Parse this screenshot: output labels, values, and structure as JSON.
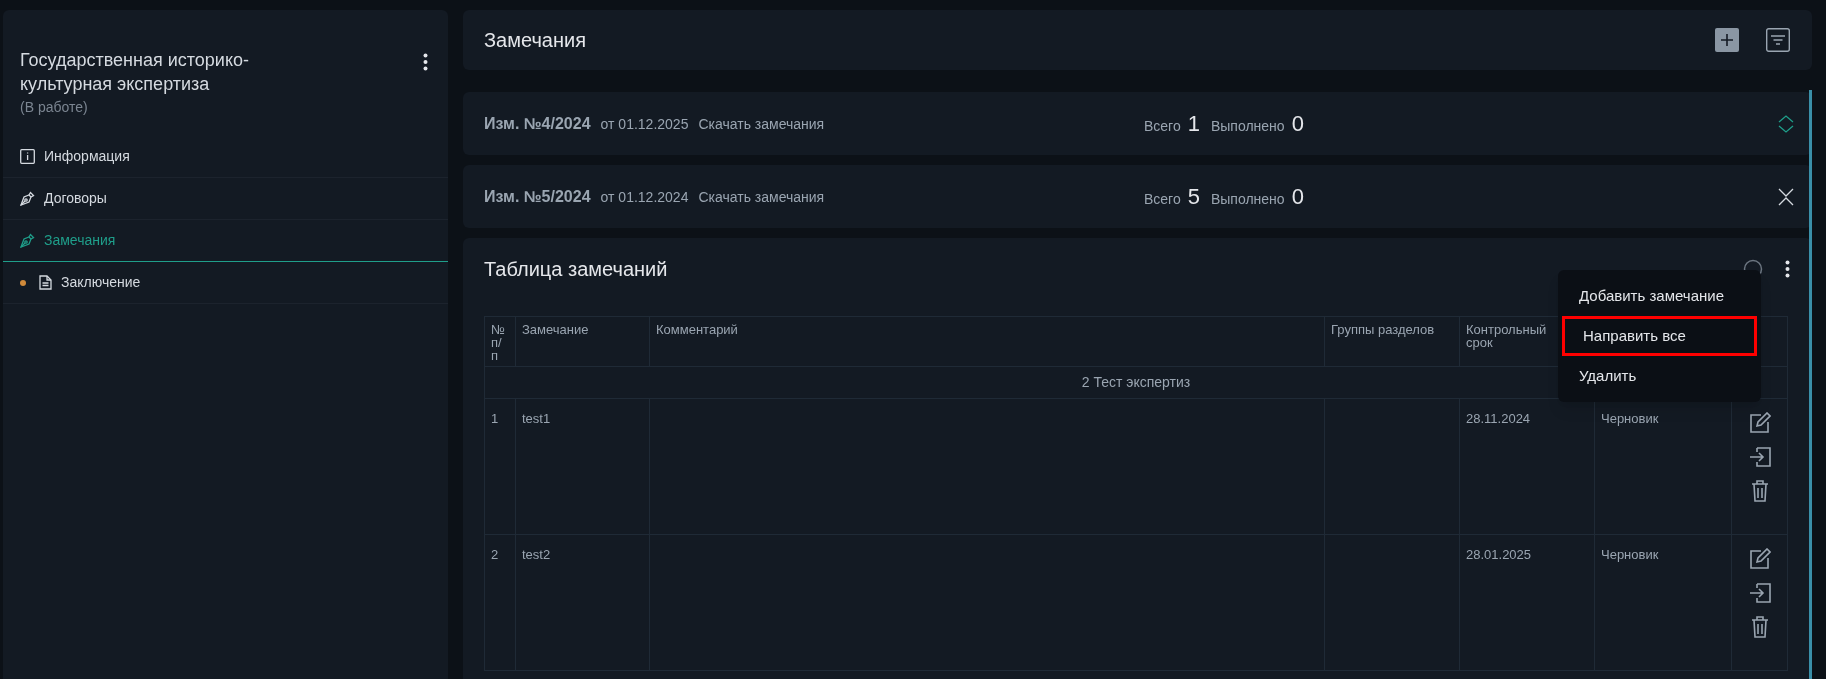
{
  "sidebar": {
    "title": "Государственная историко-культурная экспертиза",
    "status": "(В работе)",
    "items": [
      {
        "label": "Информация",
        "selected": false,
        "marked": false
      },
      {
        "label": "Договоры",
        "selected": false,
        "marked": false
      },
      {
        "label": "Замечания",
        "selected": true,
        "marked": false
      },
      {
        "label": "Заключение",
        "selected": false,
        "marked": true
      }
    ]
  },
  "header": {
    "title": "Замечания"
  },
  "revisions": [
    {
      "title": "Изм. №4/2024",
      "date": "от 01.12.2025",
      "link": "Скачать замечания",
      "total_label": "Всего",
      "total": "1",
      "done_label": "Выполнено",
      "done": "0",
      "expanded": false
    },
    {
      "title": "Изм. №5/2024",
      "date": "от 01.12.2024",
      "link": "Скачать замечания",
      "total_label": "Всего",
      "total": "5",
      "done_label": "Выполнено",
      "done": "0",
      "expanded": true
    }
  ],
  "table_panel": {
    "title": "Таблица замечаний",
    "columns": [
      "№ п/п",
      "Замечание",
      "Комментарий",
      "Группы разделов",
      "Контрольный срок"
    ],
    "group": "2 Тест экспертиз",
    "rows": [
      {
        "number": "1",
        "remark": "test1",
        "deadline": "28.11.2024",
        "status": "Черновик"
      },
      {
        "number": "2",
        "remark": "test2",
        "deadline": "28.01.2025",
        "status": "Черновик"
      }
    ]
  },
  "menu": {
    "items": [
      {
        "label": "Добавить замечание",
        "outlined": false
      },
      {
        "label": "Направить все",
        "outlined": true
      },
      {
        "label": "Удалить",
        "outlined": false
      }
    ]
  }
}
